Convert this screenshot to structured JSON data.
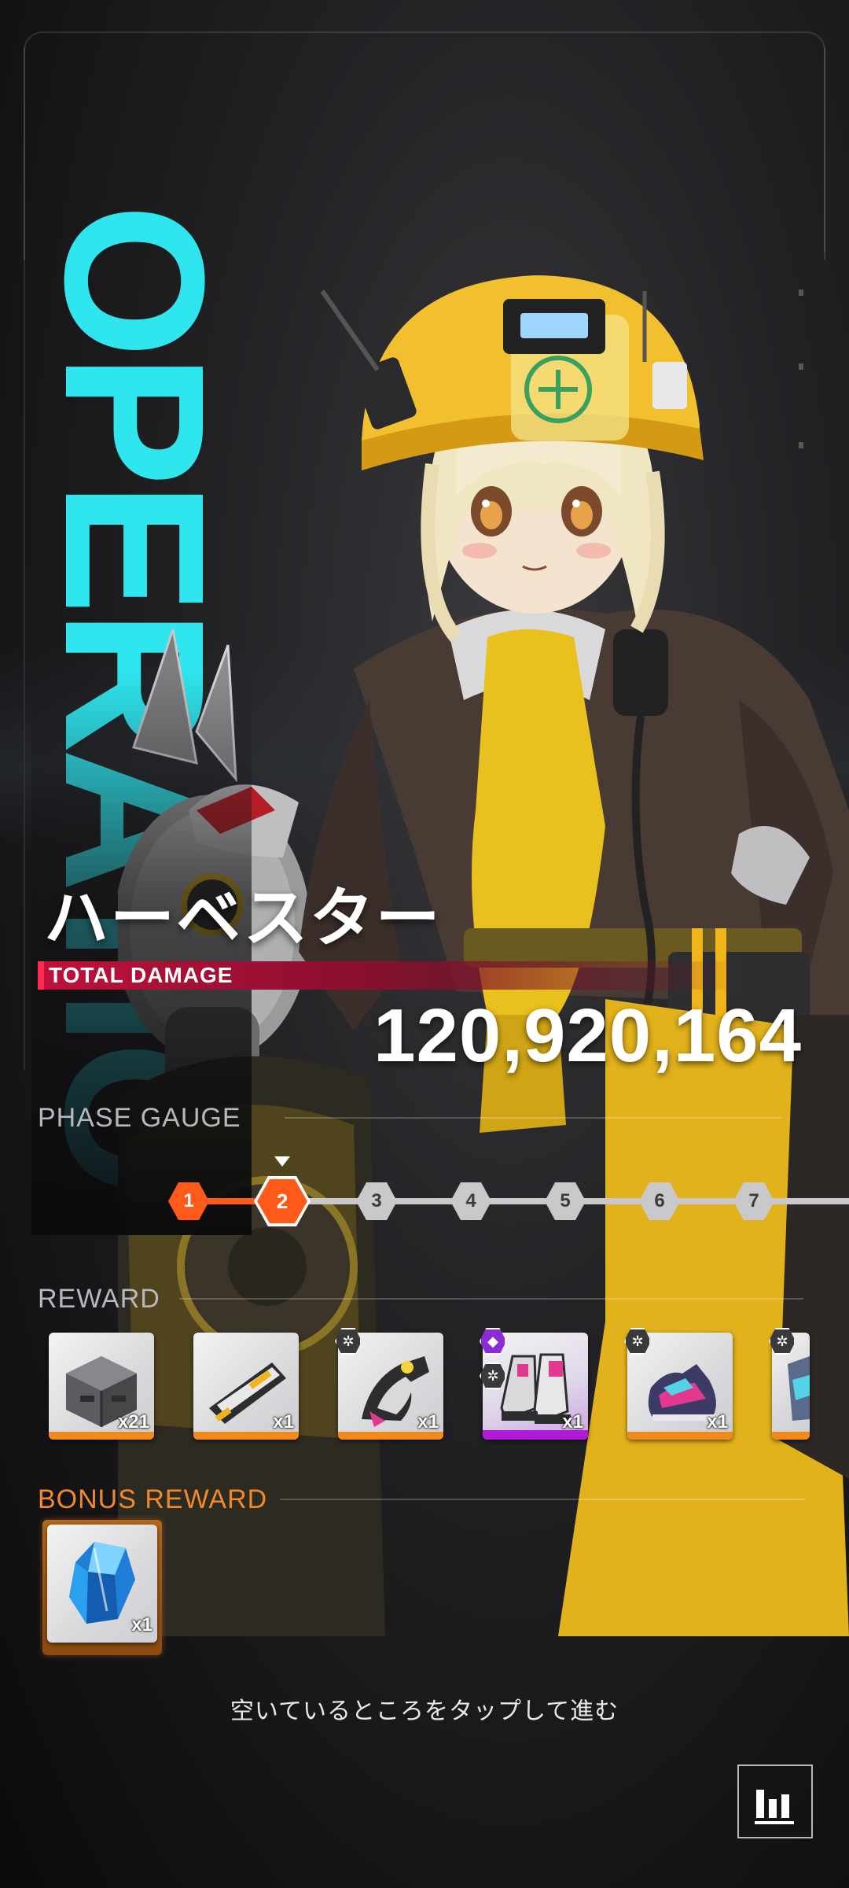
{
  "side_title": "OPERATION",
  "boss": {
    "name": "ハーベスター"
  },
  "damage": {
    "label": "TOTAL DAMAGE",
    "value": "120,920,164"
  },
  "phase_gauge": {
    "title": "PHASE GAUGE",
    "phases": [
      "1",
      "2",
      "3",
      "4",
      "5",
      "6",
      "7"
    ],
    "current_phase": 2
  },
  "reward": {
    "title": "REWARD",
    "items": [
      {
        "name": "supply-crate",
        "qty": "x21",
        "rarity": "gold"
      },
      {
        "name": "module-chip",
        "qty": "x1",
        "rarity": "gold"
      },
      {
        "name": "gauntlet-gear",
        "qty": "x1",
        "rarity": "gold"
      },
      {
        "name": "boots-gear-epic",
        "qty": "x1",
        "rarity": "epic"
      },
      {
        "name": "sneaker-gear",
        "qty": "x1",
        "rarity": "gold"
      },
      {
        "name": "partial-item",
        "qty": "",
        "rarity": "gold"
      }
    ]
  },
  "bonus_reward": {
    "title": "BONUS REWARD",
    "items": [
      {
        "name": "blue-crystal",
        "qty": "x1"
      }
    ]
  },
  "footer": {
    "tap_hint": "空いているところをタップして進む"
  },
  "colors": {
    "accent_cyan": "#2fe6ef",
    "phase_orange": "#ff5a1a",
    "damage_red": "#c0103c",
    "bonus_orange": "#f08a1a",
    "epic_purple": "#b11ad9"
  }
}
